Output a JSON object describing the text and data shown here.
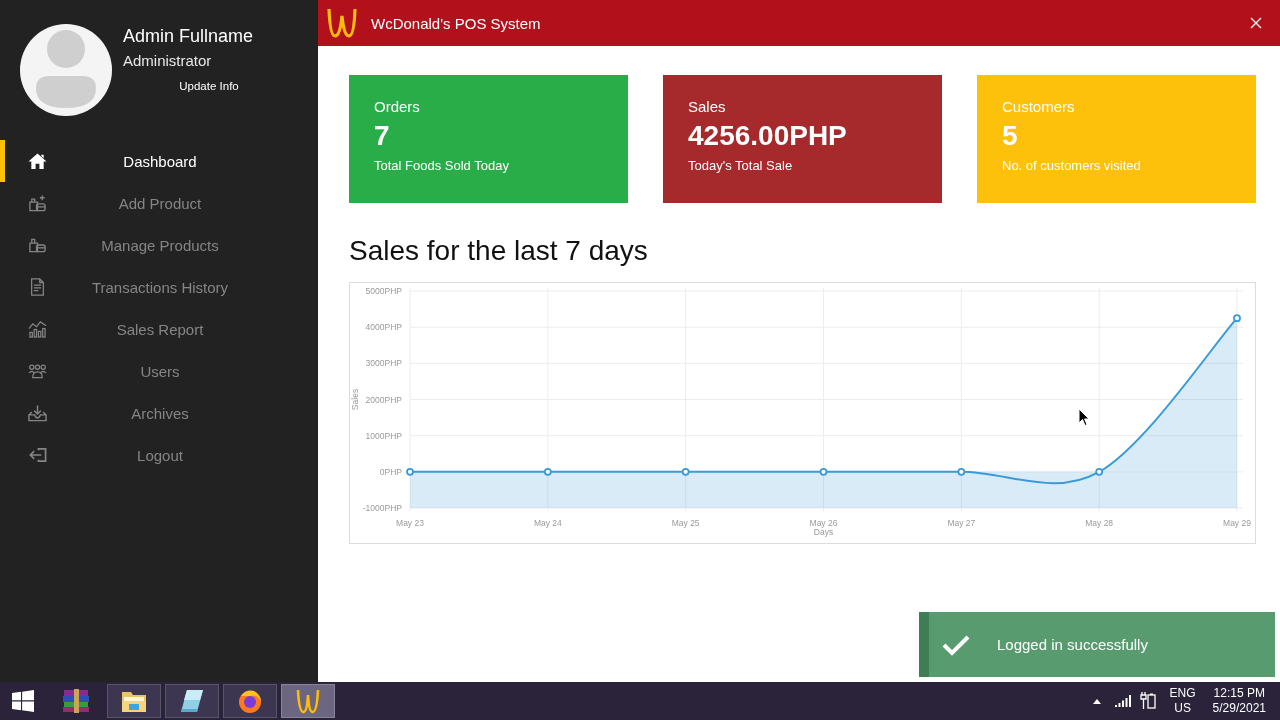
{
  "window": {
    "title": "WcDonald's POS System"
  },
  "sidebar": {
    "profile": {
      "name": "Admin Fullname",
      "role": "Administrator",
      "link": "Update Info"
    },
    "items": [
      {
        "label": "Dashboard",
        "selected": true
      },
      {
        "label": "Add Product",
        "selected": false
      },
      {
        "label": "Manage Products",
        "selected": false
      },
      {
        "label": "Transactions History",
        "selected": false
      },
      {
        "label": "Sales Report",
        "selected": false
      },
      {
        "label": "Users",
        "selected": false
      },
      {
        "label": "Archives",
        "selected": false
      },
      {
        "label": "Logout",
        "selected": false
      }
    ]
  },
  "cards": [
    {
      "title": "Orders",
      "value": "7",
      "caption": "Total Foods Sold Today",
      "color": "#28ad48"
    },
    {
      "title": "Sales",
      "value": "4256.00PHP",
      "caption": "Today's Total Sale",
      "color": "#a6292c"
    },
    {
      "title": "Customers",
      "value": "5",
      "caption": "No. of customers visited",
      "color": "#fdc10b"
    }
  ],
  "chart_section": {
    "heading": "Sales for the last 7 days",
    "chart_data": [
      {
        "type": "area",
        "xlabel": "Days",
        "ylabel": "Sales",
        "categories": [
          "May 23",
          "May 24",
          "May 25",
          "May 26",
          "May 27",
          "May 28",
          "May 29"
        ],
        "values": [
          0,
          0,
          0,
          0,
          0,
          0,
          4250
        ],
        "color": "#3a9ad9",
        "ylim": [
          -1000,
          5000
        ],
        "yticks": [
          {
            "value": -1000,
            "label": "-1000PHP"
          },
          {
            "value": 0,
            "label": "0PHP"
          },
          {
            "value": 1000,
            "label": "1000PHP"
          },
          {
            "value": 2000,
            "label": "2000PHP"
          },
          {
            "value": 3000,
            "label": "3000PHP"
          },
          {
            "value": 4000,
            "label": "4000PHP"
          },
          {
            "value": 5000,
            "label": "5000PHP"
          }
        ],
        "bands": [
          {
            "axis": "y",
            "from": -1000,
            "to": 0,
            "color": "#3a9ad9"
          }
        ],
        "grid": true,
        "marker": "circle"
      }
    ]
  },
  "toast": {
    "message": "Logged in successfully"
  },
  "taskbar": {
    "apps": [
      {
        "running": false,
        "selected": false
      },
      {
        "running": true,
        "selected": false
      },
      {
        "running": true,
        "selected": false
      },
      {
        "running": true,
        "selected": false
      },
      {
        "running": true,
        "selected": true
      }
    ],
    "language": "ENG",
    "region": "US",
    "time": "12:15 PM",
    "date": "5/29/2021"
  }
}
